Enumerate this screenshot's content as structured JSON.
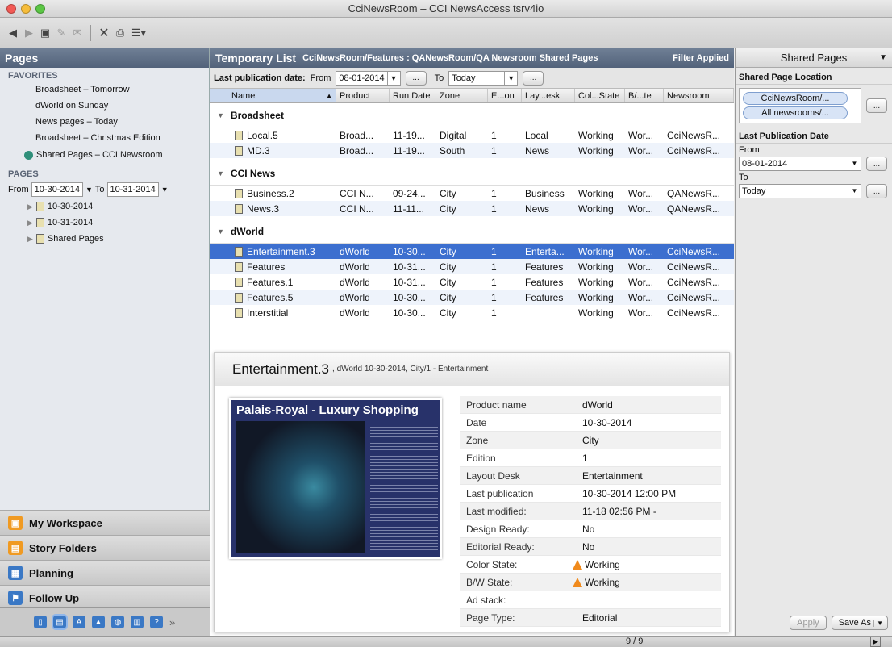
{
  "window": {
    "title": "CciNewsRoom – CCI NewsAccess tsrv4io"
  },
  "left": {
    "header": "Pages",
    "favorites_title": "FAVORITES",
    "favorites": [
      "Broadsheet – Tomorrow",
      "dWorld on Sunday",
      "News pages – Today",
      "Broadsheet – Christmas Edition",
      "Shared Pages – CCI Newsroom"
    ],
    "pages_title": "PAGES",
    "from_label": "From",
    "from_value": "10-30-2014",
    "to_label": "To",
    "to_value": "10-31-2014",
    "tree": [
      "10-30-2014",
      "10-31-2014",
      "Shared Pages"
    ],
    "nav": [
      "My Workspace",
      "Story Folders",
      "Planning",
      "Follow Up"
    ],
    "more_glyph": "»"
  },
  "middle": {
    "title": "Temporary List",
    "path": "CciNewsRoom/Features : QANewsRoom/QA Newsroom Shared Pages",
    "filter": "Filter Applied",
    "pub_label": "Last publication date:",
    "from_label": "From",
    "from_value": "08-01-2014",
    "to_label": "To",
    "to_value": "Today",
    "ellipsis": "...",
    "columns": [
      "Name",
      "Product",
      "Run Date",
      "Zone",
      "E...on",
      "Lay...esk",
      "Col...State",
      "B/...te",
      "Newsroom"
    ],
    "groups": [
      {
        "name": "Broadsheet",
        "rows": [
          [
            "Local.5",
            "Broad...",
            "11-19...",
            "Digital",
            "1",
            "Local",
            "Working",
            "Wor...",
            "CciNewsR..."
          ],
          [
            "MD.3",
            "Broad...",
            "11-19...",
            "South",
            "1",
            "News",
            "Working",
            "Wor...",
            "CciNewsR..."
          ]
        ]
      },
      {
        "name": "CCI News",
        "rows": [
          [
            "Business.2",
            "CCI N...",
            "09-24...",
            "City",
            "1",
            "Business",
            "Working",
            "Wor...",
            "QANewsR..."
          ],
          [
            "News.3",
            "CCI N...",
            "11-11...",
            "City",
            "1",
            "News",
            "Working",
            "Wor...",
            "QANewsR..."
          ]
        ]
      },
      {
        "name": "dWorld",
        "rows": [
          [
            "Entertainment.3",
            "dWorld",
            "10-30...",
            "City",
            "1",
            "Enterta...",
            "Working",
            "Wor...",
            "CciNewsR..."
          ],
          [
            "Features",
            "dWorld",
            "10-31...",
            "City",
            "1",
            "Features",
            "Working",
            "Wor...",
            "CciNewsR..."
          ],
          [
            "Features.1",
            "dWorld",
            "10-31...",
            "City",
            "1",
            "Features",
            "Working",
            "Wor...",
            "CciNewsR..."
          ],
          [
            "Features.5",
            "dWorld",
            "10-30...",
            "City",
            "1",
            "Features",
            "Working",
            "Wor...",
            "CciNewsR..."
          ],
          [
            "Interstitial",
            "dWorld",
            "10-30...",
            "City",
            "1",
            "",
            "Working",
            "Wor...",
            "CciNewsR..."
          ]
        ]
      }
    ],
    "detail": {
      "title": "Entertainment.3",
      "subtitle": ", dWorld 10-30-2014, City/1 - Entertainment",
      "thumb_title": "Palais-Royal - Luxury Shopping",
      "props": [
        [
          "Product name",
          "dWorld"
        ],
        [
          "Date",
          "10-30-2014"
        ],
        [
          "Zone",
          "City"
        ],
        [
          "Edition",
          "1"
        ],
        [
          "Layout Desk",
          "Entertainment"
        ],
        [
          "Last publication",
          "10-30-2014 12:00 PM"
        ],
        [
          "Last modified:",
          "11-18 02:56 PM -"
        ],
        [
          "Design Ready:",
          "No"
        ],
        [
          "Editorial Ready:",
          "No"
        ],
        [
          "Color State:",
          "Working"
        ],
        [
          "B/W State:",
          "Working"
        ],
        [
          "Ad stack:",
          ""
        ],
        [
          "Page Type:",
          "Editorial"
        ]
      ]
    }
  },
  "right": {
    "header": "Shared Pages",
    "loc_title": "Shared Page Location",
    "loc_pills": [
      "CciNewsRoom/...",
      "All newsrooms/..."
    ],
    "pub_title": "Last Publication Date",
    "from_label": "From",
    "from_value": "08-01-2014",
    "to_label": "To",
    "to_value": "Today",
    "apply": "Apply",
    "save_as": "Save As"
  },
  "status": {
    "count": "9 / 9"
  }
}
